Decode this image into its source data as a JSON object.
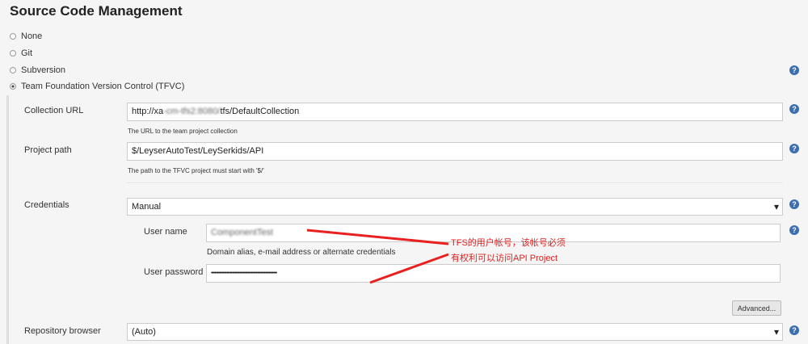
{
  "title": "Source Code Management",
  "scm_options": [
    {
      "label": "None",
      "selected": false
    },
    {
      "label": "Git",
      "selected": false
    },
    {
      "label": "Subversion",
      "selected": false
    },
    {
      "label": "Team Foundation Version Control (TFVC)",
      "selected": true
    }
  ],
  "collection_url": {
    "label": "Collection URL",
    "value_prefix": "http://xa",
    "value_masked": "-cm-tfs2:8080/",
    "value_suffix": "tfs/DefaultCollection",
    "hint": "The URL to the team project collection"
  },
  "project_path": {
    "label": "Project path",
    "value": "$/LeyserAutoTest/LeySerkids/API",
    "hint": "The path to the TFVC project must start with '$/'"
  },
  "credentials": {
    "label": "Credentials",
    "value": "Manual"
  },
  "user_name": {
    "label": "User name",
    "value": "ComponentTest",
    "hint": "Domain alias, e-mail address or alternate credentials"
  },
  "user_password": {
    "label": "User password",
    "value": "••••••••••••••••••••••••••••••••••••••••••••••••••••••••"
  },
  "advanced_label": "Advanced...",
  "repository_browser": {
    "label": "Repository browser",
    "value": "(Auto)"
  },
  "annotation": {
    "line1": "TFS的用户帐号，该帐号必须",
    "line2": "有权利可以访问API Project"
  },
  "help_glyph": "?",
  "colors": {
    "annotation": "#e02020",
    "help": "#3b6fb0"
  }
}
